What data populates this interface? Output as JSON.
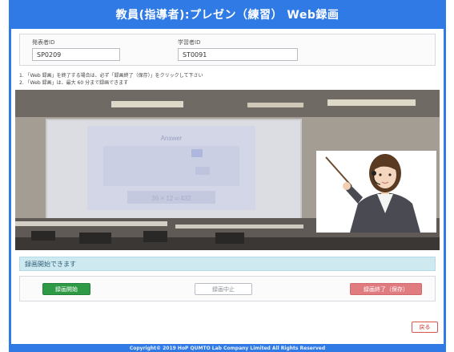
{
  "header": {
    "title": "教員(指導者):プレゼン（練習） Web録画"
  },
  "ids": {
    "presenter": {
      "label": "発表者ID",
      "value": "SP0209"
    },
    "student": {
      "label": "学習者ID",
      "value": "ST0091"
    }
  },
  "notes": [
    "1. 「Web 録画」を終了する場合は、必ず「録画終了（保存）」をクリックして下さい",
    "2. 「Web 録画」は、最大 60 分まで録画できます"
  ],
  "video": {
    "slide_title": "Answer",
    "slide_equation": "36 × 12 = 432"
  },
  "status": {
    "text": "録画開始できます"
  },
  "buttons": {
    "start": "録画開始",
    "stop": "録画中止",
    "end": "録画終了（保存）",
    "back": "戻る"
  },
  "footer": {
    "copyright": "Copyright© 2019 HoP QUMTO Lab Company Limited All Rights Reserved"
  },
  "colors": {
    "primary": "#2f7ae5",
    "success": "#2e9a46",
    "danger": "#e07b80",
    "info_bg": "#cfe9f1"
  }
}
